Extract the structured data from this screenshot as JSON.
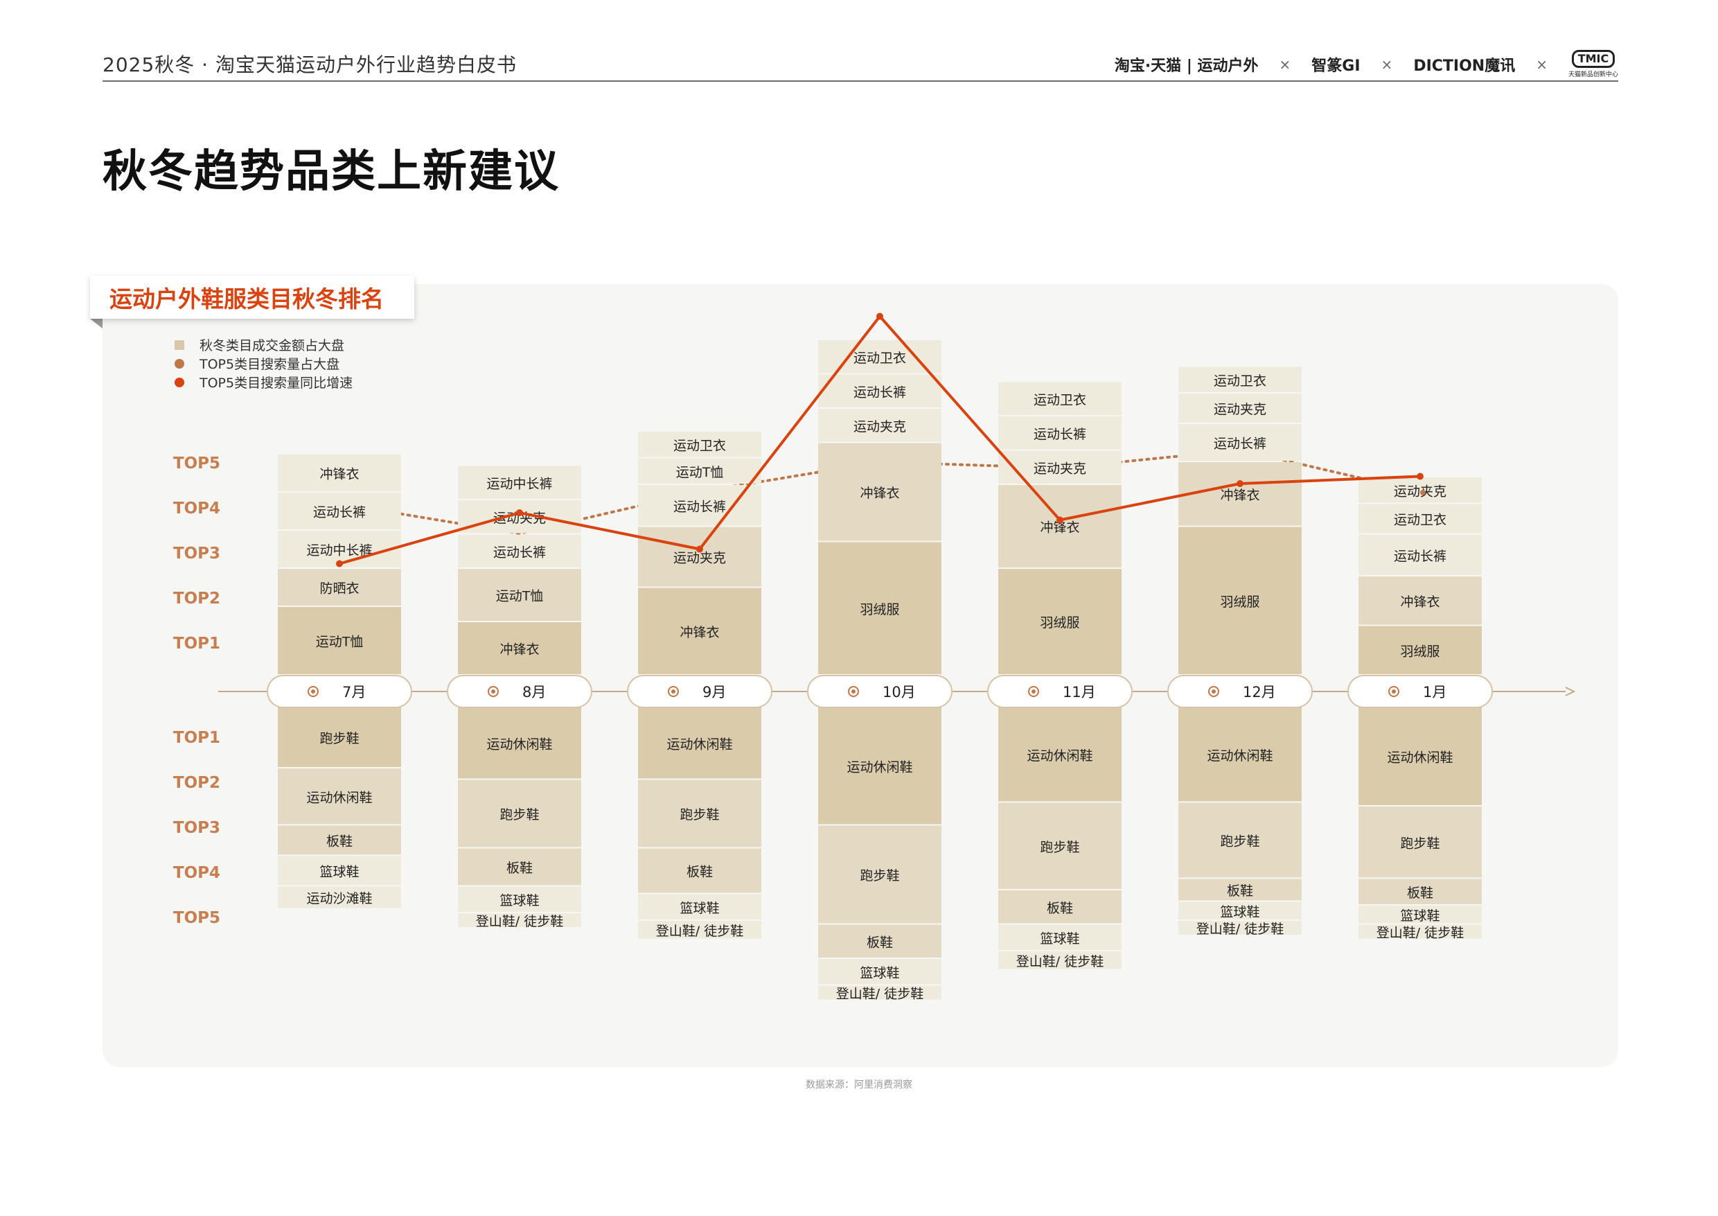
{
  "header": {
    "title": "2025秋冬 · 淘宝天猫运动户外行业趋势白皮书",
    "logos": [
      "淘宝·天猫 | 运动户外",
      "智篆GI",
      "DICTION魔讯",
      "TMIC"
    ],
    "logo_sub": "天猫新品创新中心",
    "separator": "×"
  },
  "page_title": "秋冬趋势品类上新建议",
  "section_tab": "运动户外鞋服类目秋冬排名",
  "legend": [
    {
      "label": "秋冬类目成交金额占大盘",
      "color": "#d8c8aa",
      "shape": "square"
    },
    {
      "label": "TOP5类目搜索量占大盘",
      "color": "#c0784a",
      "shape": "dot"
    },
    {
      "label": "TOP5类目搜索量同比增速",
      "color": "#d9430f",
      "shape": "dot"
    }
  ],
  "rank_labels_upper": [
    "TOP5",
    "TOP4",
    "TOP3",
    "TOP2",
    "TOP1"
  ],
  "rank_labels_lower": [
    "TOP1",
    "TOP2",
    "TOP3",
    "TOP4",
    "TOP5"
  ],
  "source": "数据来源：阿里消费洞察",
  "colors": {
    "seg_light": "#eeeadc",
    "seg_mid": "#e4dac3",
    "seg_dark": "#dacbab",
    "line_growth": "#d9430f",
    "line_search": "#c0784a",
    "axis": "#c9a889"
  },
  "chart_data": {
    "type": "bar",
    "months": [
      "7月",
      "8月",
      "9月",
      "10月",
      "11月",
      "12月",
      "1月"
    ],
    "apparel": [
      [
        {
          "name": "运动T恤",
          "value": 18
        },
        {
          "name": "防晒衣",
          "value": 10
        },
        {
          "name": "运动中长裤",
          "value": 10
        },
        {
          "name": "运动长裤",
          "value": 10
        },
        {
          "name": "冲锋衣",
          "value": 10
        }
      ],
      [
        {
          "name": "冲锋衣",
          "value": 14
        },
        {
          "name": "运动T恤",
          "value": 14
        },
        {
          "name": "运动长裤",
          "value": 9
        },
        {
          "name": "运动夹克",
          "value": 9
        },
        {
          "name": "运动中长裤",
          "value": 9
        }
      ],
      [
        {
          "name": "冲锋衣",
          "value": 23
        },
        {
          "name": "运动夹克",
          "value": 16
        },
        {
          "name": "运动长裤",
          "value": 11
        },
        {
          "name": "运动T恤",
          "value": 7
        },
        {
          "name": "运动卫衣",
          "value": 7
        }
      ],
      [
        {
          "name": "羽绒服",
          "value": 35
        },
        {
          "name": "冲锋衣",
          "value": 26
        },
        {
          "name": "运动夹克",
          "value": 9
        },
        {
          "name": "运动长裤",
          "value": 9
        },
        {
          "name": "运动卫衣",
          "value": 9
        }
      ],
      [
        {
          "name": "羽绒服",
          "value": 28
        },
        {
          "name": "冲锋衣",
          "value": 22
        },
        {
          "name": "运动夹克",
          "value": 9
        },
        {
          "name": "运动长裤",
          "value": 9
        },
        {
          "name": "运动卫衣",
          "value": 9
        }
      ],
      [
        {
          "name": "羽绒服",
          "value": 39
        },
        {
          "name": "冲锋衣",
          "value": 17
        },
        {
          "name": "运动长裤",
          "value": 10
        },
        {
          "name": "运动夹克",
          "value": 8
        },
        {
          "name": "运动卫衣",
          "value": 7
        }
      ],
      [
        {
          "name": "羽绒服",
          "value": 13
        },
        {
          "name": "冲锋衣",
          "value": 13
        },
        {
          "name": "运动长裤",
          "value": 11
        },
        {
          "name": "运动卫衣",
          "value": 8
        },
        {
          "name": "运动夹克",
          "value": 7
        }
      ]
    ],
    "footwear": [
      [
        {
          "name": "跑步鞋",
          "value": 16
        },
        {
          "name": "运动休闲鞋",
          "value": 15
        },
        {
          "name": "板鞋",
          "value": 8
        },
        {
          "name": "篮球鞋",
          "value": 8
        },
        {
          "name": "运动沙滩鞋",
          "value": 6
        }
      ],
      [
        {
          "name": "运动休闲鞋",
          "value": 19
        },
        {
          "name": "跑步鞋",
          "value": 18
        },
        {
          "name": "板鞋",
          "value": 10
        },
        {
          "name": "篮球鞋",
          "value": 7
        },
        {
          "name": "登山鞋/ 徒步鞋",
          "value": 4
        }
      ],
      [
        {
          "name": "运动休闲鞋",
          "value": 19
        },
        {
          "name": "跑步鞋",
          "value": 18
        },
        {
          "name": "板鞋",
          "value": 12
        },
        {
          "name": "篮球鞋",
          "value": 7
        },
        {
          "name": "登山鞋/ 徒步鞋",
          "value": 5
        }
      ],
      [
        {
          "name": "运动休闲鞋",
          "value": 31
        },
        {
          "name": "跑步鞋",
          "value": 26
        },
        {
          "name": "板鞋",
          "value": 9
        },
        {
          "name": "篮球鞋",
          "value": 7
        },
        {
          "name": "登山鞋/ 徒步鞋",
          "value": 4
        }
      ],
      [
        {
          "name": "运动休闲鞋",
          "value": 25
        },
        {
          "name": "跑步鞋",
          "value": 23
        },
        {
          "name": "板鞋",
          "value": 9
        },
        {
          "name": "篮球鞋",
          "value": 7
        },
        {
          "name": "登山鞋/ 徒步鞋",
          "value": 5
        }
      ],
      [
        {
          "name": "运动休闲鞋",
          "value": 25
        },
        {
          "name": "跑步鞋",
          "value": 20
        },
        {
          "name": "板鞋",
          "value": 6
        },
        {
          "name": "篮球鞋",
          "value": 5
        },
        {
          "name": "登山鞋/ 徒步鞋",
          "value": 4
        }
      ],
      [
        {
          "name": "运动休闲鞋",
          "value": 26
        },
        {
          "name": "跑步鞋",
          "value": 19
        },
        {
          "name": "板鞋",
          "value": 7
        },
        {
          "name": "篮球鞋",
          "value": 5
        },
        {
          "name": "登山鞋/ 徒步鞋",
          "value": 4
        }
      ]
    ],
    "series": [
      {
        "name": "TOP5类目搜索量同比增速",
        "values": [
          13,
          20,
          15,
          47,
          19,
          24,
          25
        ]
      },
      {
        "name": "TOP5类目搜索量占大盘",
        "values": [
          55,
          50,
          57,
          62,
          61,
          64,
          57
        ]
      }
    ]
  }
}
